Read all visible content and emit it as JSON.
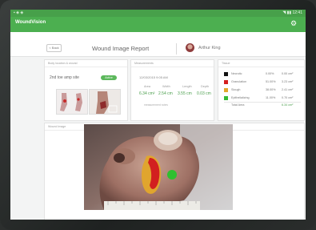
{
  "status_bar": {
    "left": "▪ ◈ ◈",
    "right": "◥ ▮▮ 12:41"
  },
  "app": {
    "logo": "WoundVision"
  },
  "header": {
    "back_label": "< Back",
    "title": "Wound Image Report",
    "patient_name": "Arthur King"
  },
  "location_card": {
    "heading": "Body location & wound",
    "site_name": "2nd toe amp site",
    "badge": "Active"
  },
  "measure_card": {
    "heading": "Measurements",
    "date": "12/03/2015  9:05 AM",
    "labels": [
      "Area",
      "Width",
      "Length",
      "Depth"
    ],
    "values": [
      "6.34 cm²",
      "2.54 cm",
      "3.55 cm",
      "0.03 cm"
    ],
    "note": "measurement notes"
  },
  "tissue_card": {
    "heading": "Tissue",
    "rows": [
      {
        "name": "Necrotic",
        "pct": "0.00%",
        "area": "0.00 cm²",
        "color": "#111111"
      },
      {
        "name": "Granulation",
        "pct": "51.00%",
        "area": "3.23 cm²",
        "color": "#d41f1f"
      },
      {
        "name": "Slough",
        "pct": "38.00%",
        "area": "2.41 cm²",
        "color": "#e3a62b"
      },
      {
        "name": "Epithelializing",
        "pct": "11.00%",
        "area": "0.70 cm²",
        "color": "#35b935"
      }
    ],
    "total_label": "Total Area",
    "total_value": "6.34 cm²"
  },
  "image_card": {
    "heading": "Wound Image"
  },
  "colors": {
    "brand_green": "#4caf50"
  }
}
